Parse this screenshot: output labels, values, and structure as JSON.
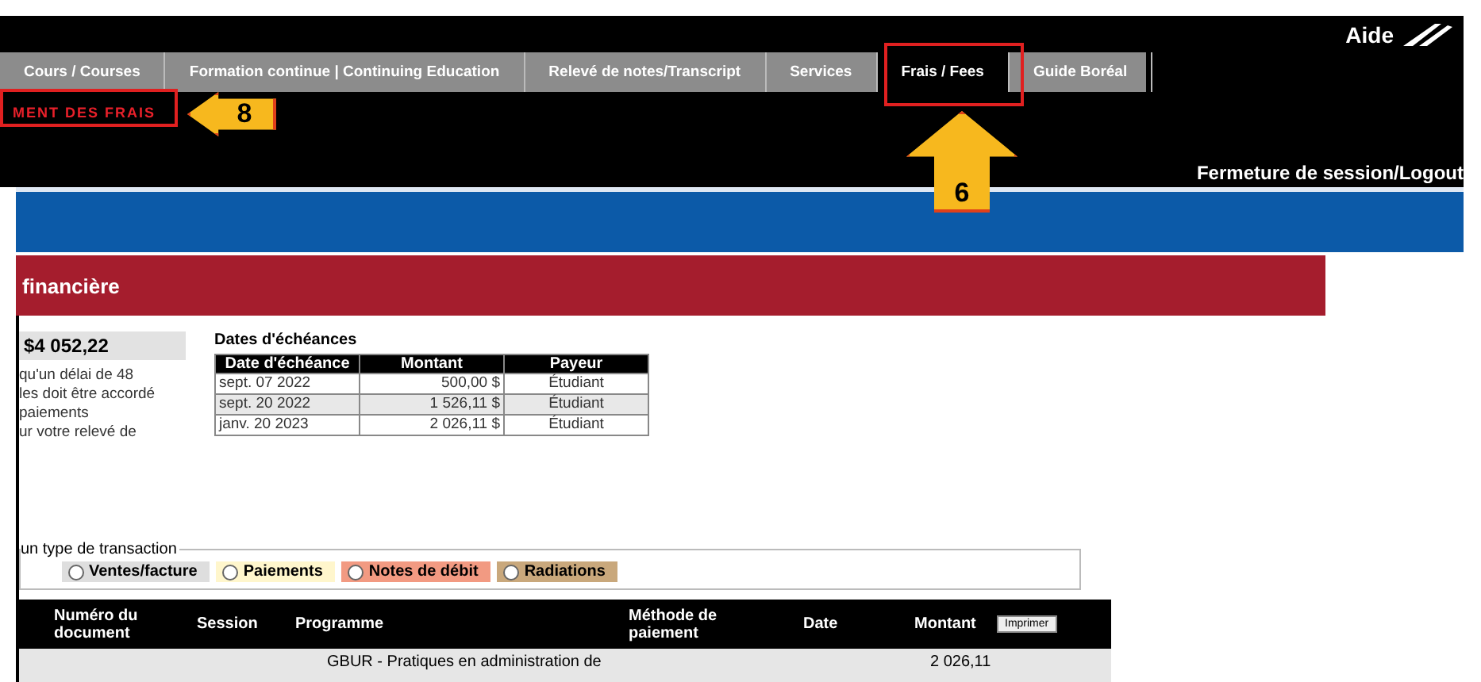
{
  "header": {
    "help": "Aide",
    "logout": "Fermeture de session/Logout",
    "submenu": "MENT DES FRAIS"
  },
  "tabs": [
    {
      "label": "Cours / Courses",
      "selected": false
    },
    {
      "label": "Formation continue | Continuing Education",
      "selected": false
    },
    {
      "label": "Relevé de notes/Transcript",
      "selected": false
    },
    {
      "label": "Services",
      "selected": false
    },
    {
      "label": "Frais / Fees",
      "selected": true
    },
    {
      "label": "Guide Boréal",
      "selected": false
    }
  ],
  "section_title": "financière",
  "balance": "$4 052,22",
  "notice_lines": [
    "qu'un délai de 48",
    "les doit être accordé",
    "paiements",
    "ur votre relevé de"
  ],
  "due_dates": {
    "title": "Dates d'échéances",
    "columns": [
      "Date d'échéance",
      "Montant",
      "Payeur"
    ],
    "rows": [
      [
        "sept. 07 2022",
        "500,00 $",
        "Étudiant"
      ],
      [
        "sept. 20 2022",
        "1 526,11 $",
        "Étudiant"
      ],
      [
        "janv. 20 2023",
        "2 026,11 $",
        "Étudiant"
      ]
    ]
  },
  "transaction_filter": {
    "legend": "un type de transaction",
    "options": [
      {
        "label": "Ventes/facture",
        "selected": false,
        "color": "#dedede"
      },
      {
        "label": "Paiements",
        "selected": false,
        "color": "#fff6cc"
      },
      {
        "label": "Notes de débit",
        "selected": false,
        "color": "#f29a82"
      },
      {
        "label": "Radiations",
        "selected": false,
        "color": "#c9a87c"
      }
    ]
  },
  "transactions": {
    "columns": [
      "Numéro du document",
      "Session",
      "Programme",
      "Méthode de paiement",
      "Date",
      "Montant"
    ],
    "print_button": "Imprimer",
    "rows": [
      {
        "program": "GBUR - Pratiques en administration de",
        "amount": "2 026,11"
      }
    ]
  },
  "callouts": [
    {
      "number": "8",
      "kind": "left"
    },
    {
      "number": "6",
      "kind": "up"
    }
  ]
}
